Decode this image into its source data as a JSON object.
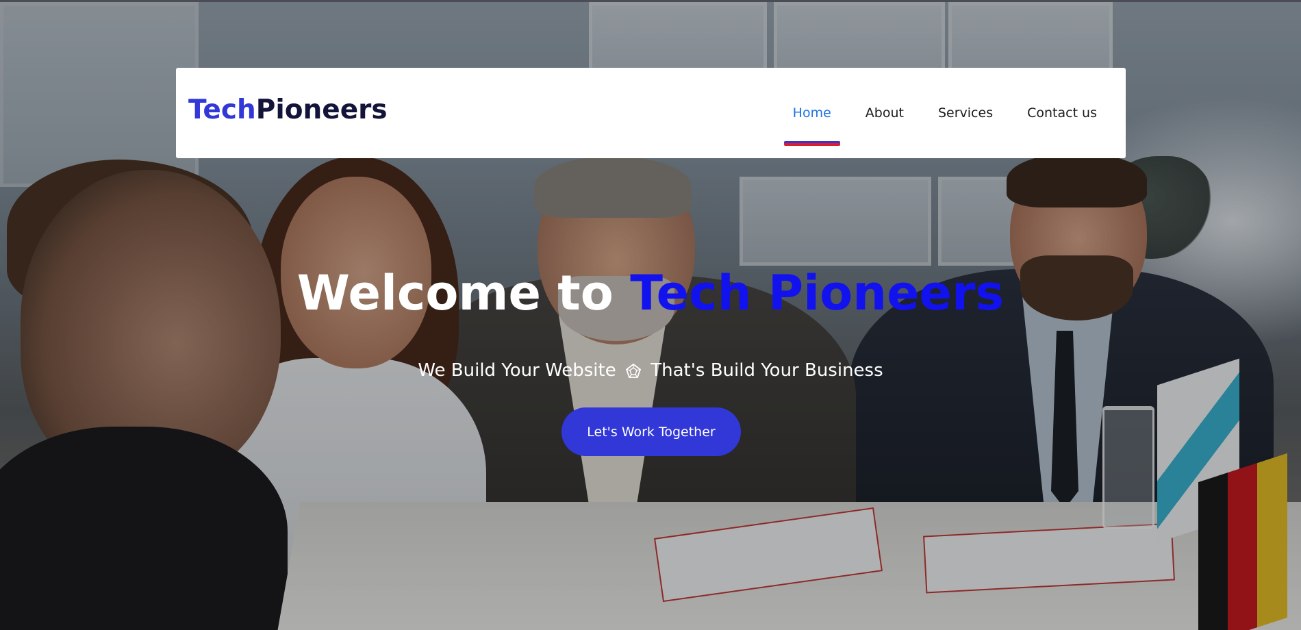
{
  "brand": {
    "logo_part1": "Tech",
    "logo_part2": "Pioneers"
  },
  "nav": {
    "items": [
      {
        "label": "Home",
        "active": true
      },
      {
        "label": "About",
        "active": false
      },
      {
        "label": "Services",
        "active": false
      },
      {
        "label": "Contact us",
        "active": false
      }
    ]
  },
  "hero": {
    "title_part1": "Welcome to ",
    "title_part2": "Tech Pioneers",
    "subtitle_part1": "We Build Your Website",
    "subtitle_icon": "pentagon-web-icon",
    "subtitle_part2": "That's Build Your Business",
    "cta_label": "Let's Work Together",
    "background_image": "business-meeting-photo"
  },
  "colors": {
    "brand_blue": "#3237d8",
    "brand_dark": "#13143a",
    "title_blue": "#1212ee",
    "nav_active": "#1b74e4",
    "underline_red": "#d81f2a"
  }
}
